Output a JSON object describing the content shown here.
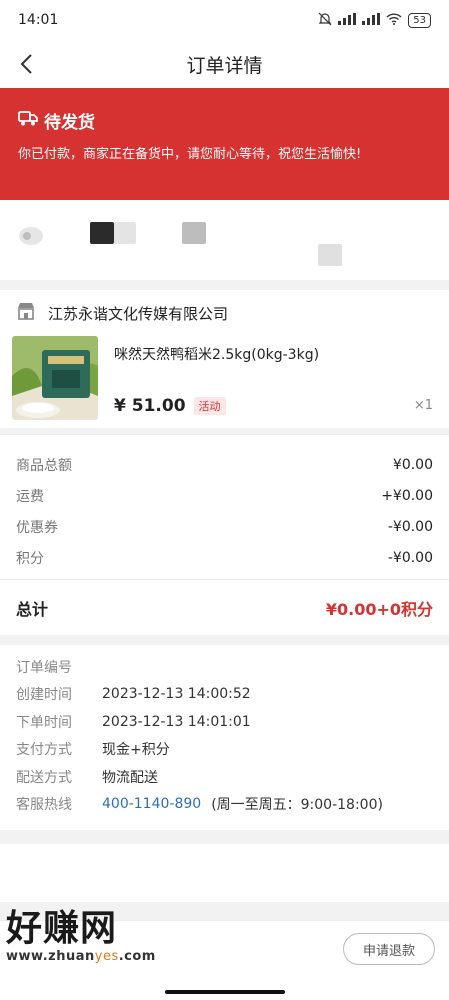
{
  "status_bar": {
    "time": "14:01",
    "battery": "53"
  },
  "nav": {
    "title": "订单详情"
  },
  "order_status": {
    "title": "待发货",
    "description": "你已付款，商家正在备货中，请您耐心等待，祝您生活愉快!"
  },
  "shop": {
    "name": "江苏永谐文化传媒有限公司"
  },
  "product": {
    "name": "咪然天然鸭稻米2.5kg(0kg-3kg)",
    "price": "¥ 51.00",
    "tag": "活动",
    "quantity": "×1"
  },
  "fees": [
    {
      "label": "商品总额",
      "value": "¥0.00"
    },
    {
      "label": "运费",
      "value": "+¥0.00"
    },
    {
      "label": "优惠券",
      "value": "-¥0.00"
    },
    {
      "label": "积分",
      "value": "-¥0.00"
    }
  ],
  "total": {
    "label": "总计",
    "value": "¥0.00+0积分"
  },
  "order_info": [
    {
      "label": "订单编号",
      "value": ""
    },
    {
      "label": "创建时间",
      "value": "2023-12-13 14:00:52"
    },
    {
      "label": "下单时间",
      "value": "2023-12-13 14:01:01"
    },
    {
      "label": "支付方式",
      "value": "现金+积分"
    },
    {
      "label": "配送方式",
      "value": "物流配送"
    },
    {
      "label": "客服热线",
      "value": "400-1140-890",
      "extra": "(周一至周五：9:00-18:00)"
    }
  ],
  "actions": {
    "refund": "申请退款"
  },
  "watermark": {
    "text": "好赚网",
    "url_prefix": "www.zhuan",
    "url_highlight": "yes",
    "url_suffix": ".com"
  },
  "colors": {
    "accent": "#d63232",
    "link": "#2f6fb5"
  }
}
